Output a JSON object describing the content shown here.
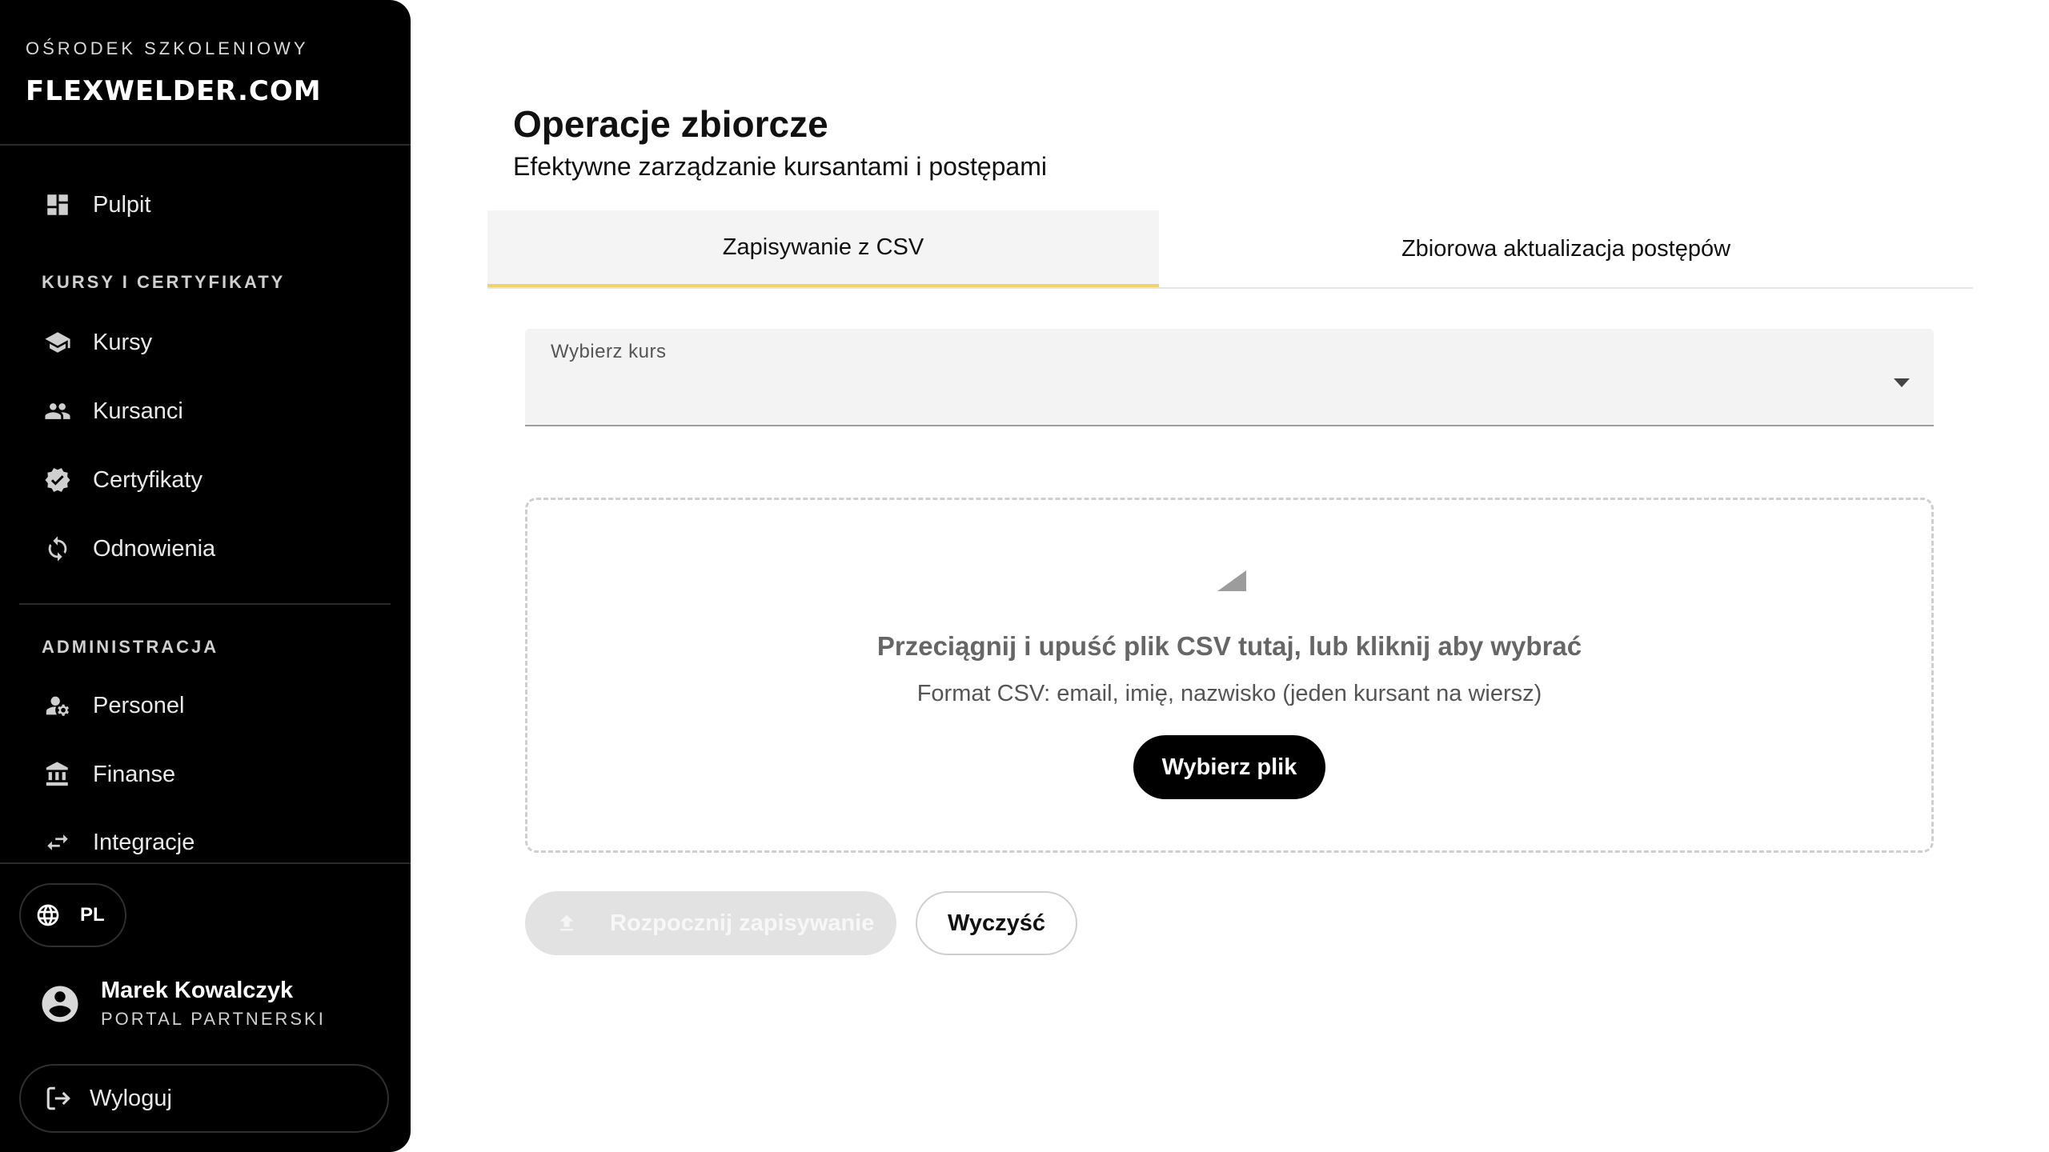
{
  "sidebar": {
    "brand_subtitle": "OŚRODEK SZKOLENIOWY",
    "brand_logo": "FLEXWELDER.COM",
    "items": {
      "dashboard": {
        "label": "Pulpit",
        "icon": "dashboard-icon"
      },
      "courses": {
        "label": "Kursy",
        "icon": "school-icon"
      },
      "students": {
        "label": "Kursanci",
        "icon": "people-icon"
      },
      "certificates": {
        "label": "Certyfikaty",
        "icon": "verified-badge-icon"
      },
      "renewals": {
        "label": "Odnowienia",
        "icon": "refresh-icon"
      },
      "staff": {
        "label": "Personel",
        "icon": "manage-accounts-icon"
      },
      "finance": {
        "label": "Finanse",
        "icon": "bank-icon"
      },
      "integrations": {
        "label": "Integracje",
        "icon": "swap-arrows-icon"
      }
    },
    "sections": {
      "courses_certificates": "KURSY I CERTYFIKATY",
      "administration": "ADMINISTRACJA"
    },
    "language": "PL",
    "user": {
      "name": "Marek Kowalczyk",
      "role": "PORTAL PARTNERSKI"
    },
    "logout_label": "Wyloguj"
  },
  "main": {
    "title": "Operacje zbiorcze",
    "subtitle": "Efektywne zarządzanie kursantami i postępami",
    "tabs": [
      {
        "label": "Zapisywanie z CSV",
        "active": true
      },
      {
        "label": "Zbiorowa aktualizacja postępów",
        "active": false
      }
    ],
    "course_select": {
      "label": "Wybierz kurs",
      "value": ""
    },
    "dropzone": {
      "title": "Przeciągnij i upuść plik CSV tutaj, lub kliknij aby wybrać",
      "hint": "Format CSV: email, imię, nazwisko (jeden kursant na wiersz)",
      "button_label": "Wybierz plik"
    },
    "actions": {
      "start_label": "Rozpocznij zapisywanie",
      "clear_label": "Wyczyść"
    }
  },
  "colors": {
    "sidebar_bg": "#000000",
    "tab_accent": "#f1d36b",
    "disabled_button": "#e2e2e2"
  }
}
